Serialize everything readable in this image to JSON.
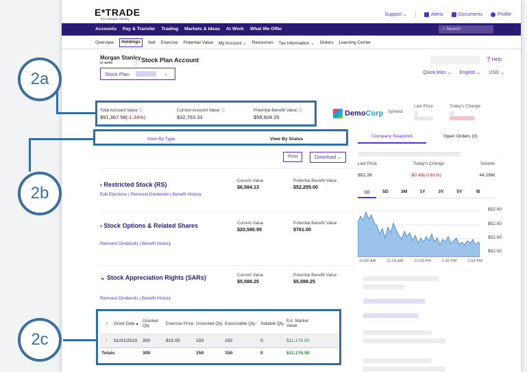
{
  "header": {
    "logo": "E*TRADE",
    "logo_sub": "from Morgan Stanley",
    "links": [
      "Support ⌄",
      "Alerts",
      "Documents",
      "Profile"
    ]
  },
  "nav": {
    "items": [
      "Accounts",
      "Pay & Transfer",
      "Trading",
      "Markets & Ideas",
      "At Work",
      "What We Offer"
    ],
    "search_placeholder": "Search"
  },
  "subnav": {
    "items": [
      "Overview",
      "Holdings",
      "Sell",
      "Exercise",
      "Potential Value",
      "My Account ⌄",
      "Resources",
      "Tax Information ⌄",
      "Orders",
      "Learning Center"
    ]
  },
  "account": {
    "ms": "Morgan Stanley",
    "atwork": "AT WORK",
    "title": "Stock Plan Account",
    "plan_label": "Stock Plan",
    "help": "Help",
    "quick": [
      "Quick links ⌄",
      "English ⌄",
      "USD ⌄"
    ]
  },
  "values": [
    {
      "label": "Total Account Value ⓘ",
      "value": "$91,367.58",
      "change": "(-1.34%)"
    },
    {
      "label": "Current Account Value ⓘ",
      "value": "$32,763.33",
      "change": ""
    },
    {
      "label": "Potential Benefit Value ⓘ",
      "value": "$58,604.25",
      "change": ""
    }
  ],
  "company": {
    "name_part1": "Demo",
    "name_part2": "Corp",
    "symbol_label": "Symbol",
    "last_price_label": "Last Price",
    "today_change_label": "Today's Change"
  },
  "tabs": {
    "by_type": "View By Type",
    "by_status": "View By Status"
  },
  "right_tabs": {
    "snapshot": "Company Snapshot",
    "orders": "Open Orders (0)"
  },
  "actions": {
    "print": "Print",
    "download": "Download ⌄"
  },
  "cards": [
    {
      "title": "› Restricted Stock (RS)",
      "links": "Edit Elections  |  Reinvest Dividends  |  Benefit History",
      "cv_label": "Current Value",
      "cv": "$6,584.13",
      "pb_label": "Potential Benefit Value",
      "pb": "$52,255.00"
    },
    {
      "title": "› Stock Options & Related Shares",
      "links": "Reinvest Dividends  |  Benefit History",
      "cv_label": "Current Value",
      "cv": "$20,590.95",
      "pb_label": "Potential Benefit Value",
      "pb": "$761.00"
    },
    {
      "title": "⌄ Stock Appreciation Rights (SARs)",
      "links": "Reinvest Dividends  |  Benefit History",
      "cv_label": "Current Value",
      "cv": "$5,588.25",
      "pb_label": "Potential Benefit Value",
      "pb": "$5,588.25"
    }
  ],
  "grant_table": {
    "headers": [
      "+",
      "Grant Date ▴",
      "Granted Qty.",
      "Exercise Price",
      "Unvested Qty.",
      "Exercisable Qty.",
      "Sellable Qty.",
      "Est. Market Value"
    ],
    "row": [
      "›",
      "01/01/2023",
      "300",
      "$15.00",
      "150",
      "150",
      "0",
      "$11,176.50"
    ],
    "totals": [
      "Totals",
      "",
      "300",
      "",
      "150",
      "150",
      "0",
      "$11,176.50"
    ]
  },
  "quote": {
    "headers": [
      "Last Price",
      "Today's Change",
      "Volume"
    ],
    "values": [
      "$52.26",
      "-$0.43(-0.81%)",
      "44.28M"
    ],
    "ranges": [
      "1D",
      "5D",
      "3M",
      "1Y",
      "3Y",
      "5Y"
    ],
    "y_labels": [
      "$52.00",
      "$52.00",
      "$52.00",
      "$52.00"
    ],
    "x_labels": [
      "10:06 AM",
      "11:18 AM",
      "12:30 PM",
      "1:42 PM",
      "2:54 PM"
    ]
  },
  "annotations": [
    "2a",
    "2b",
    "2c"
  ],
  "colors": {
    "brand": "#2b1a73",
    "accent": "#5a2ec8",
    "negative": "#d0021b",
    "positive": "#1b8a2b",
    "callout": "#2f6da6"
  }
}
